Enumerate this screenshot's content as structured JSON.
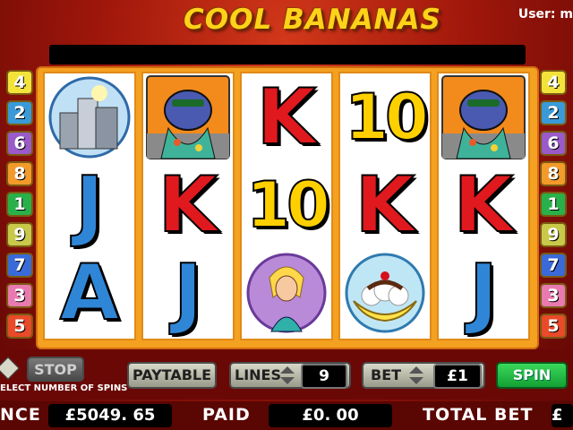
{
  "game_title": "COOL BANANAS",
  "user_label": "User: m",
  "line_buttons": {
    "left": [
      "4",
      "2",
      "6",
      "8",
      "1",
      "9",
      "7",
      "3",
      "5"
    ],
    "right": [
      "4",
      "2",
      "6",
      "8",
      "1",
      "9",
      "7",
      "3",
      "5"
    ],
    "colors": [
      "#f2e23a",
      "#3a9ad8",
      "#9a5ac8",
      "#f29a2a",
      "#2ab04a",
      "#c8c84a",
      "#3a6ad8",
      "#e87ab0",
      "#e84a2a"
    ]
  },
  "reels": [
    {
      "top": "skyscraper-icon",
      "middle": "J",
      "bottom": "A"
    },
    {
      "top": "gorilla-icon",
      "middle": "K",
      "bottom": "J"
    },
    {
      "top": "K",
      "middle": "10",
      "bottom": "girl-icon"
    },
    {
      "top": "10",
      "middle": "K",
      "bottom": "banana-split-icon"
    },
    {
      "top": "gorilla-icon",
      "middle": "K",
      "bottom": "J"
    }
  ],
  "controls": {
    "stop_label": "STOP",
    "spins_caption": "ELECT NUMBER OF SPINS",
    "paytable_label": "PAYTABLE",
    "lines_label": "LINES",
    "lines_value": "9",
    "bet_label": "BET",
    "bet_value": "£1",
    "spin_label": "SPIN"
  },
  "status": {
    "balance_label": "NCE",
    "balance_value": "£5049. 65",
    "paid_label": "PAID",
    "paid_value": "£0. 00",
    "total_bet_label": "TOTAL BET",
    "total_bet_value": "£"
  }
}
